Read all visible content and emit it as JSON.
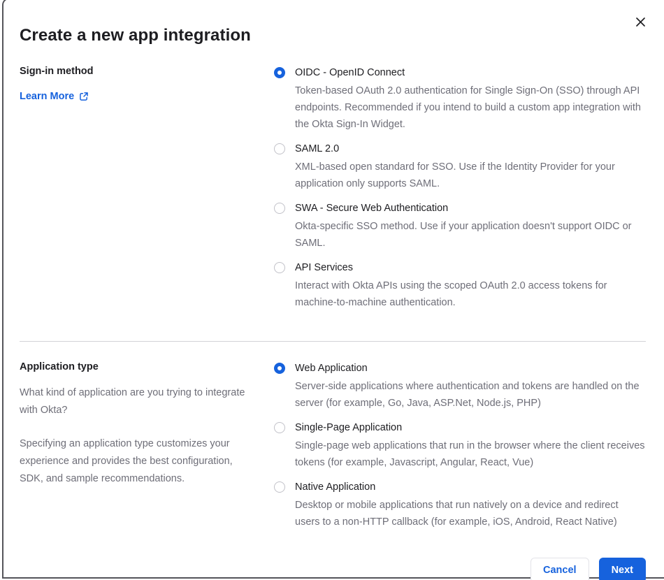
{
  "modal": {
    "title": "Create a new app integration"
  },
  "icons": {
    "close": "x-cross",
    "external_link": "box-with-arrow-up-right"
  },
  "colors": {
    "primary_blue": "#1662dd",
    "text_dark": "#1d1d21",
    "text_gray": "#6e6e78",
    "divider": "#d2d2d7",
    "modal_border": "#54545a",
    "radio_unselected_border": "#c1c1c8"
  },
  "sections": [
    {
      "label": "Sign-in method",
      "link": {
        "label": "Learn More"
      },
      "options": [
        {
          "label": "OIDC - OpenID Connect",
          "description": "Token-based OAuth 2.0 authentication for Single Sign-On (SSO) through API endpoints. Recommended if you intend to build a custom app integration with the Okta Sign-In Widget.",
          "selected": true
        },
        {
          "label": "SAML 2.0",
          "description": "XML-based open standard for SSO. Use if the Identity Provider for your application only supports SAML.",
          "selected": false
        },
        {
          "label": "SWA - Secure Web Authentication",
          "description": "Okta-specific SSO method. Use if your application doesn't support OIDC or SAML.",
          "selected": false
        },
        {
          "label": "API Services",
          "description": "Interact with Okta APIs using the scoped OAuth 2.0 access tokens for machine-to-machine authentication.",
          "selected": false
        }
      ]
    },
    {
      "label": "Application type",
      "paragraphs": [
        "What kind of application are you trying to integrate with Okta?",
        "Specifying an application type customizes your experience and provides the best configuration, SDK, and sample recommendations."
      ],
      "options": [
        {
          "label": "Web Application",
          "description": "Server-side applications where authentication and tokens are handled on the server (for example, Go, Java, ASP.Net, Node.js, PHP)",
          "selected": true
        },
        {
          "label": "Single-Page Application",
          "description": "Single-page web applications that run in the browser where the client receives tokens (for example, Javascript, Angular, React, Vue)",
          "selected": false
        },
        {
          "label": "Native Application",
          "description": "Desktop or mobile applications that run natively on a device and redirect users to a non-HTTP callback (for example, iOS, Android, React Native)",
          "selected": false
        }
      ]
    }
  ],
  "footer": {
    "cancel_label": "Cancel",
    "next_label": "Next"
  }
}
